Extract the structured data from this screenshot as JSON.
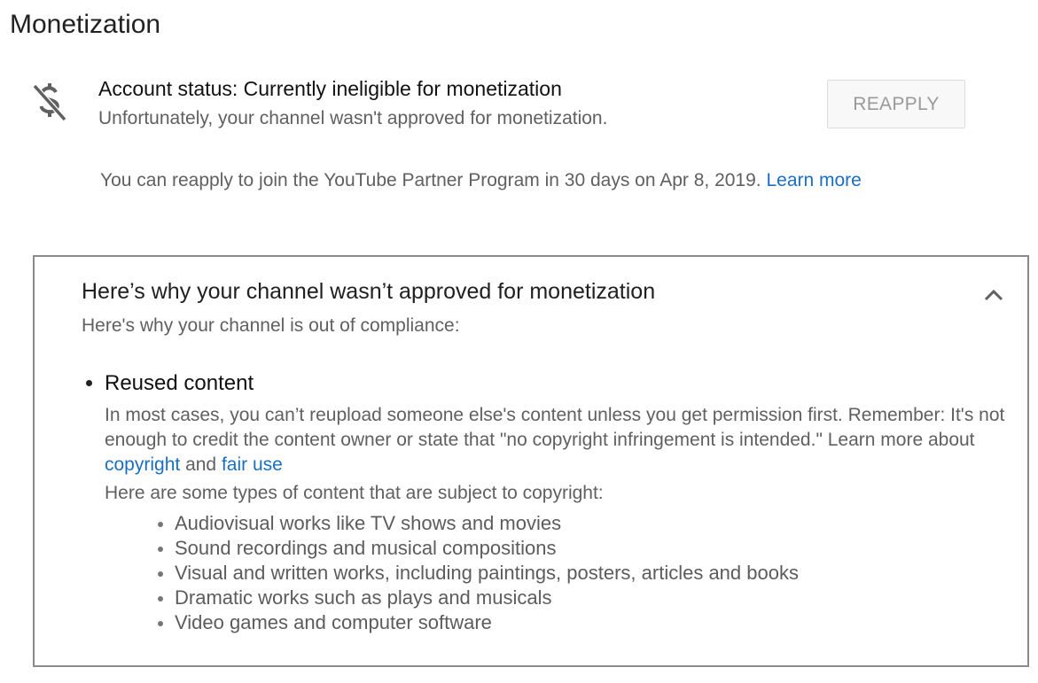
{
  "page": {
    "title": "Monetization"
  },
  "status": {
    "icon": "no-money-icon",
    "title": "Account status: Currently ineligible for monetization",
    "subtitle": "Unfortunately, your channel wasn't approved for monetization.",
    "reapply_label": "REAPPLY",
    "reapply_note": "You can reapply to join the YouTube Partner Program in 30 days on Apr 8, 2019.",
    "learn_more": "Learn more"
  },
  "panel": {
    "title": "Here’s why your channel wasn’t approved for monetization",
    "subtitle": "Here's why your channel is out of compliance:",
    "toggle_icon": "chevron-up-icon",
    "reason": {
      "title": "Reused content",
      "description_text": "In most cases, you can’t reupload someone else's content unless you get permission first. Remember: It's not enough to credit the content owner or state that \"no copyright infringement is intended.\" Learn more about",
      "copyright_link": "copyright",
      "and_text": "and",
      "fair_use_link": "fair use",
      "types_intro": "Here are some types of content that are subject to copyright:",
      "types": [
        "Audiovisual works like TV shows and movies",
        "Sound recordings and musical compositions",
        "Visual and written works, including paintings, posters, articles and books",
        "Dramatic works such as plays and musicals",
        "Video games and computer software"
      ]
    }
  },
  "colors": {
    "link": "#1a6fc4",
    "secondary_text": "#606060",
    "panel_border": "#8a8a8a"
  }
}
